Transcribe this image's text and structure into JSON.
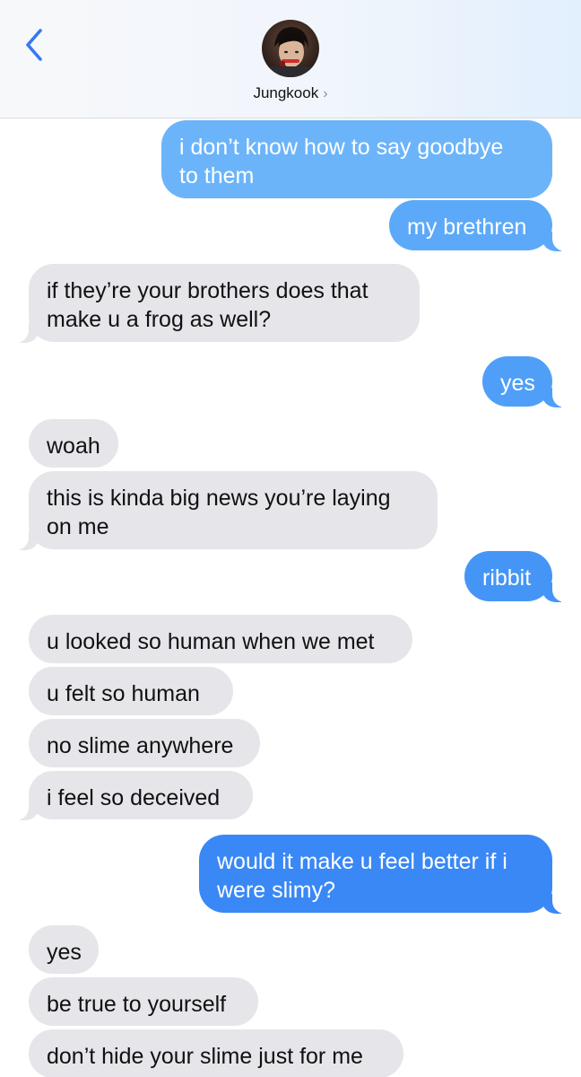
{
  "header": {
    "contact_name": "Jungkook",
    "chevron": "›",
    "back_icon": "chevron-left-icon",
    "accent_color": "#3478f6"
  },
  "messages": [
    {
      "side": "sent",
      "text": "i don’t know how to say goodbye\nto them"
    },
    {
      "side": "sent",
      "text": "my brethren"
    },
    {
      "side": "received",
      "text": "if they’re your brothers does that\nmake u a frog as well?"
    },
    {
      "side": "sent",
      "text": "yes"
    },
    {
      "side": "received",
      "text": "woah"
    },
    {
      "side": "received",
      "text": "this is kinda big news you’re laying\non me"
    },
    {
      "side": "sent",
      "text": "ribbit"
    },
    {
      "side": "received",
      "text": "u looked so human when we met"
    },
    {
      "side": "received",
      "text": "u felt so human"
    },
    {
      "side": "received",
      "text": "no slime anywhere"
    },
    {
      "side": "received",
      "text": "i feel so deceived"
    },
    {
      "side": "sent",
      "text": "would it make u feel better if i\nwere slimy?"
    },
    {
      "side": "received",
      "text": "yes"
    },
    {
      "side": "received",
      "text": "be true to yourself"
    },
    {
      "side": "received",
      "text": "don’t hide your slime just for me"
    }
  ]
}
